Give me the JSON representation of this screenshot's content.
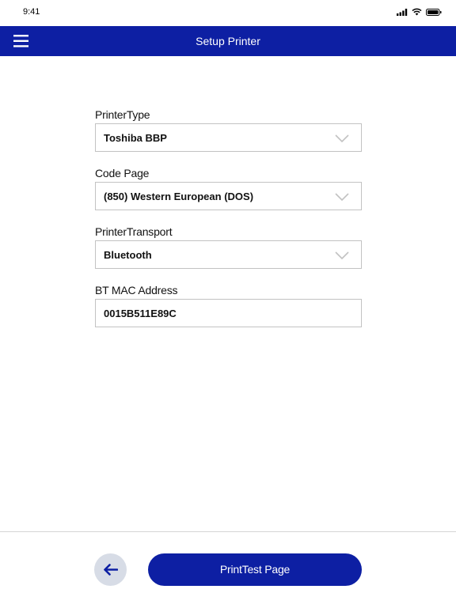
{
  "status_bar": {
    "time": "9:41",
    "icons": [
      "signal-icon",
      "wifi-icon",
      "battery-icon"
    ]
  },
  "header": {
    "title": "Setup Printer",
    "menu_icon": "hamburger-menu-icon"
  },
  "form": {
    "printer_type": {
      "label": "PrinterType",
      "value": "Toshiba BBP"
    },
    "code_page": {
      "label": "Code Page",
      "value": "(850) Western European (DOS)"
    },
    "printer_transport": {
      "label": "PrinterTransport",
      "value": "Bluetooth"
    },
    "bt_mac_address": {
      "label": "BT MAC Address",
      "value": "0015B511E89C"
    }
  },
  "footer": {
    "back_icon": "arrow-left-icon",
    "print_label": "PrintTest Page"
  },
  "colors": {
    "brand": "#0d1fa3",
    "back_button_bg": "#d7dce6",
    "border": "#c2c2c2"
  }
}
